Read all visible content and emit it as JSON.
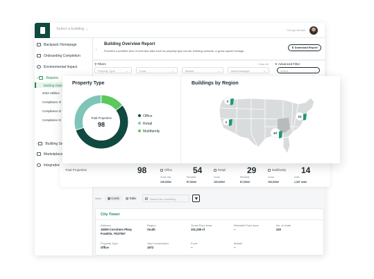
{
  "topbar": {
    "building_select": "Select a building",
    "user_name": "George Burdell"
  },
  "sidebar": {
    "items": [
      {
        "label": "Backpack Homepage"
      },
      {
        "label": "Onboarding Completion"
      },
      {
        "label": "Environmental Impact"
      },
      {
        "label": "Reports"
      },
      {
        "label": "Building Se"
      },
      {
        "label": "Marketplace"
      },
      {
        "label": "Integrations"
      }
    ],
    "report_subitems": [
      {
        "label": "Building Overv"
      },
      {
        "label": "2023 Utilities"
      },
      {
        "label": "Compliance O"
      },
      {
        "label": "Compliance D"
      },
      {
        "label": "Compliance D"
      }
    ]
  },
  "header": {
    "back": "‹",
    "title": "Building Overview Report",
    "subtitle": "Provides a portfolio view of overview data such as property type counts, building contacts, & gross square footage.",
    "download_label": "Download Report"
  },
  "filters": {
    "title": "Filters",
    "clear_all": "Clear All",
    "advanced": "Advanced Filter",
    "selects": [
      {
        "placeholder": "Property Type"
      },
      {
        "placeholder": "Fund"
      },
      {
        "placeholder": "Market"
      },
      {
        "placeholder": "Asset Manager"
      }
    ],
    "advanced_select": "Select"
  },
  "property_type": {
    "title": "Property Type",
    "center_label": "Total Properties",
    "total": "98",
    "segments": [
      {
        "name": "Office",
        "value": 54,
        "color": "#10493f"
      },
      {
        "name": "Retail",
        "value": 29,
        "color": "#7ec5b8"
      },
      {
        "name": "Multifamily",
        "value": 14,
        "color": "#5ac85a"
      }
    ]
  },
  "region": {
    "title": "Buildings by Region",
    "markers": [
      {
        "count": "2"
      },
      {
        "count": "1"
      },
      {
        "count": "21"
      },
      {
        "count": "57"
      }
    ]
  },
  "stats": {
    "total_label": "Total Properties",
    "total_value": "98",
    "categories": [
      {
        "name": "Office",
        "value": "54",
        "mini": [
          {
            "label": "Gross Sqf",
            "value": "100,000sf"
          },
          {
            "label": "Rentable",
            "value": "87,000sf"
          }
        ]
      },
      {
        "name": "Retail",
        "value": "29",
        "mini": [
          {
            "label": "Gross",
            "value": "100,000sf"
          },
          {
            "label": "Rentable",
            "value": "87,000sf"
          }
        ]
      },
      {
        "name": "Multifamily",
        "value": "14",
        "mini": [
          {
            "label": "Gross",
            "value": "100,000sf"
          },
          {
            "label": "Units",
            "value": "1,337 units"
          }
        ]
      }
    ]
  },
  "view": {
    "label": "View",
    "cards": "Cards",
    "table": "Table",
    "search_placeholder": "Search for a building..."
  },
  "building_card": {
    "title": "City Tower",
    "fields": [
      {
        "label": "Address",
        "value": "16009 Corrohers Pkwy Franklin, TN37067"
      },
      {
        "label": "Region",
        "value": "South"
      },
      {
        "label": "Gross Floor Area",
        "value": "101,299 sf"
      },
      {
        "label": "Rentable Floor Area",
        "value": "--"
      },
      {
        "label": "No. of Units",
        "value": "220"
      },
      {
        "label": "Property Type",
        "value": "Office"
      },
      {
        "label": "Year Constructed",
        "value": "1972"
      },
      {
        "label": "Fund",
        "value": "--"
      },
      {
        "label": "Market",
        "value": "--"
      }
    ]
  }
}
